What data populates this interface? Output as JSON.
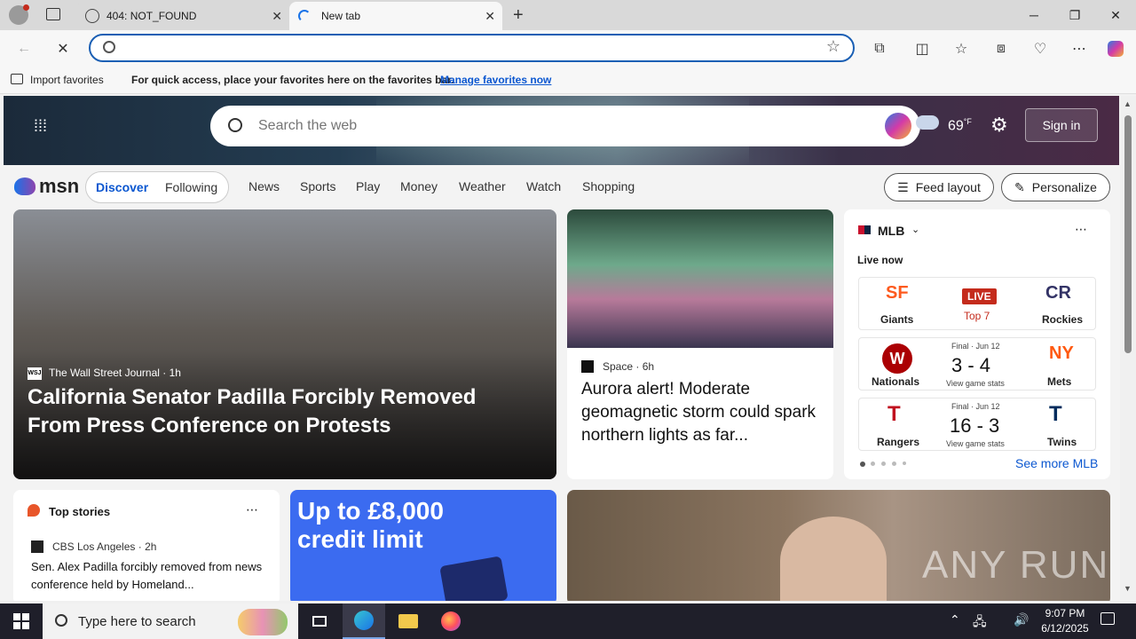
{
  "browser": {
    "tabs": [
      {
        "title": "404: NOT_FOUND",
        "active": false
      },
      {
        "title": "New tab",
        "active": true
      }
    ],
    "address": {
      "value": "",
      "placeholder": ""
    },
    "favorites_bar": {
      "import_label": "Import favorites",
      "message": "For quick access, place your favorites here on the favorites bar.",
      "manage_link": "Manage favorites now"
    }
  },
  "msn": {
    "search_placeholder": "Search the web",
    "weather_temp": "69",
    "weather_unit": "°F",
    "sign_in": "Sign in",
    "logo": "msn",
    "tabs": [
      "Discover",
      "Following"
    ],
    "nav": [
      "News",
      "Sports",
      "Play",
      "Money",
      "Weather",
      "Watch",
      "Shopping"
    ],
    "feed_layout": "Feed layout",
    "personalize": "Personalize",
    "hero_story": {
      "source": "The Wall Street Journal",
      "source_badge": "WSJ",
      "age": "1h",
      "title": "California Senator Padilla Forcibly Removed From Press Conference on Protests"
    },
    "second_story": {
      "source": "Space",
      "age": "6h",
      "title": "Aurora alert! Moderate geomagnetic storm could spark northern lights as far..."
    },
    "mlb": {
      "title": "MLB",
      "live_now": "Live now",
      "games": [
        {
          "home": "Giants",
          "away": "Rockies",
          "status": "LIVE",
          "detail": "Top 7",
          "score": ""
        },
        {
          "home": "Nationals",
          "away": "Mets",
          "status": "Final · Jun 12",
          "score": "3 - 4",
          "detail": "View game stats"
        },
        {
          "home": "Rangers",
          "away": "Twins",
          "status": "Final · Jun 12",
          "score": "16 - 3",
          "detail": "View game stats"
        }
      ],
      "see_more": "See more MLB"
    },
    "top_stories": {
      "title": "Top stories",
      "source": "CBS Los Angeles",
      "age": "2h",
      "headline": "Sen. Alex Padilla forcibly removed from news conference held by Homeland..."
    },
    "ad": {
      "line1": "Up to £8,000",
      "line2": "credit limit"
    },
    "watermark": "ANY RUN"
  },
  "taskbar": {
    "search_placeholder": "Type here to search",
    "time": "9:07 PM",
    "date": "6/12/2025"
  }
}
